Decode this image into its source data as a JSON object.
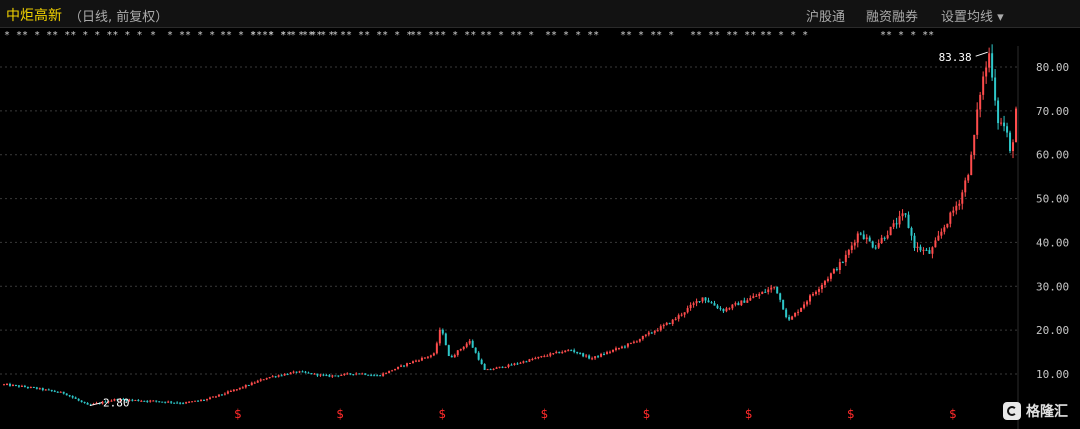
{
  "header": {
    "stock_name": "中炬高新",
    "subtitle": "（日线, 前复权）",
    "links": [
      "沪股通",
      "融资融券",
      "设置均线 ▾"
    ]
  },
  "watermark": {
    "text": "格隆汇"
  },
  "colors": {
    "up": "#ff4c4c",
    "down": "#2ec7c9",
    "background": "#000000",
    "grid": "#3a3a3a",
    "marker_text": "#cfcfcf",
    "dividend_marker": "#ff2a2a"
  },
  "chart_data": {
    "type": "candlestick",
    "title": "",
    "xlabel": "",
    "ylabel": "",
    "ylim": [
      2.0,
      89.0
    ],
    "y_ticks": [
      10.0,
      20.0,
      30.0,
      40.0,
      50.0,
      60.0,
      70.0,
      80.0
    ],
    "y_tick_labels": [
      "10.00",
      "20.00",
      "30.00",
      "40.00",
      "50.00",
      "60.00",
      "70.00",
      "80.00"
    ],
    "grid": true,
    "annotations": [
      {
        "label": "83.38",
        "value": 83.38,
        "kind": "max"
      },
      {
        "label": "2.80",
        "value": 2.8,
        "kind": "min"
      }
    ],
    "dividend_marker": "$",
    "dividend_marker_count": 8,
    "price_path": [
      {
        "t": 0.0,
        "v": 7.6
      },
      {
        "t": 0.03,
        "v": 6.8
      },
      {
        "t": 0.06,
        "v": 5.6
      },
      {
        "t": 0.083,
        "v": 2.8
      },
      {
        "t": 0.11,
        "v": 4.2
      },
      {
        "t": 0.15,
        "v": 3.8
      },
      {
        "t": 0.178,
        "v": 3.4
      },
      {
        "t": 0.2,
        "v": 4.2
      },
      {
        "t": 0.23,
        "v": 6.5
      },
      {
        "t": 0.26,
        "v": 9.2
      },
      {
        "t": 0.29,
        "v": 10.5
      },
      {
        "t": 0.32,
        "v": 9.5
      },
      {
        "t": 0.35,
        "v": 10.2
      },
      {
        "t": 0.37,
        "v": 9.6
      },
      {
        "t": 0.4,
        "v": 12.5
      },
      {
        "t": 0.425,
        "v": 14.5
      },
      {
        "t": 0.432,
        "v": 21.0
      },
      {
        "t": 0.44,
        "v": 13.5
      },
      {
        "t": 0.46,
        "v": 17.5
      },
      {
        "t": 0.475,
        "v": 10.8
      },
      {
        "t": 0.5,
        "v": 12.0
      },
      {
        "t": 0.54,
        "v": 14.5
      },
      {
        "t": 0.56,
        "v": 15.5
      },
      {
        "t": 0.58,
        "v": 13.5
      },
      {
        "t": 0.62,
        "v": 17.0
      },
      {
        "t": 0.66,
        "v": 22.0
      },
      {
        "t": 0.69,
        "v": 27.5
      },
      {
        "t": 0.71,
        "v": 24.5
      },
      {
        "t": 0.745,
        "v": 28.0
      },
      {
        "t": 0.762,
        "v": 30.0
      },
      {
        "t": 0.775,
        "v": 22.0
      },
      {
        "t": 0.8,
        "v": 28.5
      },
      {
        "t": 0.83,
        "v": 36.0
      },
      {
        "t": 0.845,
        "v": 42.5
      },
      {
        "t": 0.86,
        "v": 39.0
      },
      {
        "t": 0.89,
        "v": 46.5
      },
      {
        "t": 0.9,
        "v": 39.0
      },
      {
        "t": 0.915,
        "v": 37.5
      },
      {
        "t": 0.93,
        "v": 44.0
      },
      {
        "t": 0.945,
        "v": 50.0
      },
      {
        "t": 0.955,
        "v": 58.0
      },
      {
        "t": 0.965,
        "v": 75.0
      },
      {
        "t": 0.974,
        "v": 83.38
      },
      {
        "t": 0.982,
        "v": 68.0
      },
      {
        "t": 0.99,
        "v": 66.0
      },
      {
        "t": 0.995,
        "v": 59.0
      },
      {
        "t": 1.0,
        "v": 70.5
      }
    ]
  },
  "marker_groups": [
    "* ** * **  ** * * ** * *",
    "*",
    "* ** * *",
    "** * ** * *",
    "*  ** ** * ** *",
    "* ** * *",
    "** ** ** * *",
    "** *** * **",
    "** * ** *",
    "** * * **",
    "** * ** *",
    "** ** ** **",
    "** * * *",
    "** * * **"
  ]
}
